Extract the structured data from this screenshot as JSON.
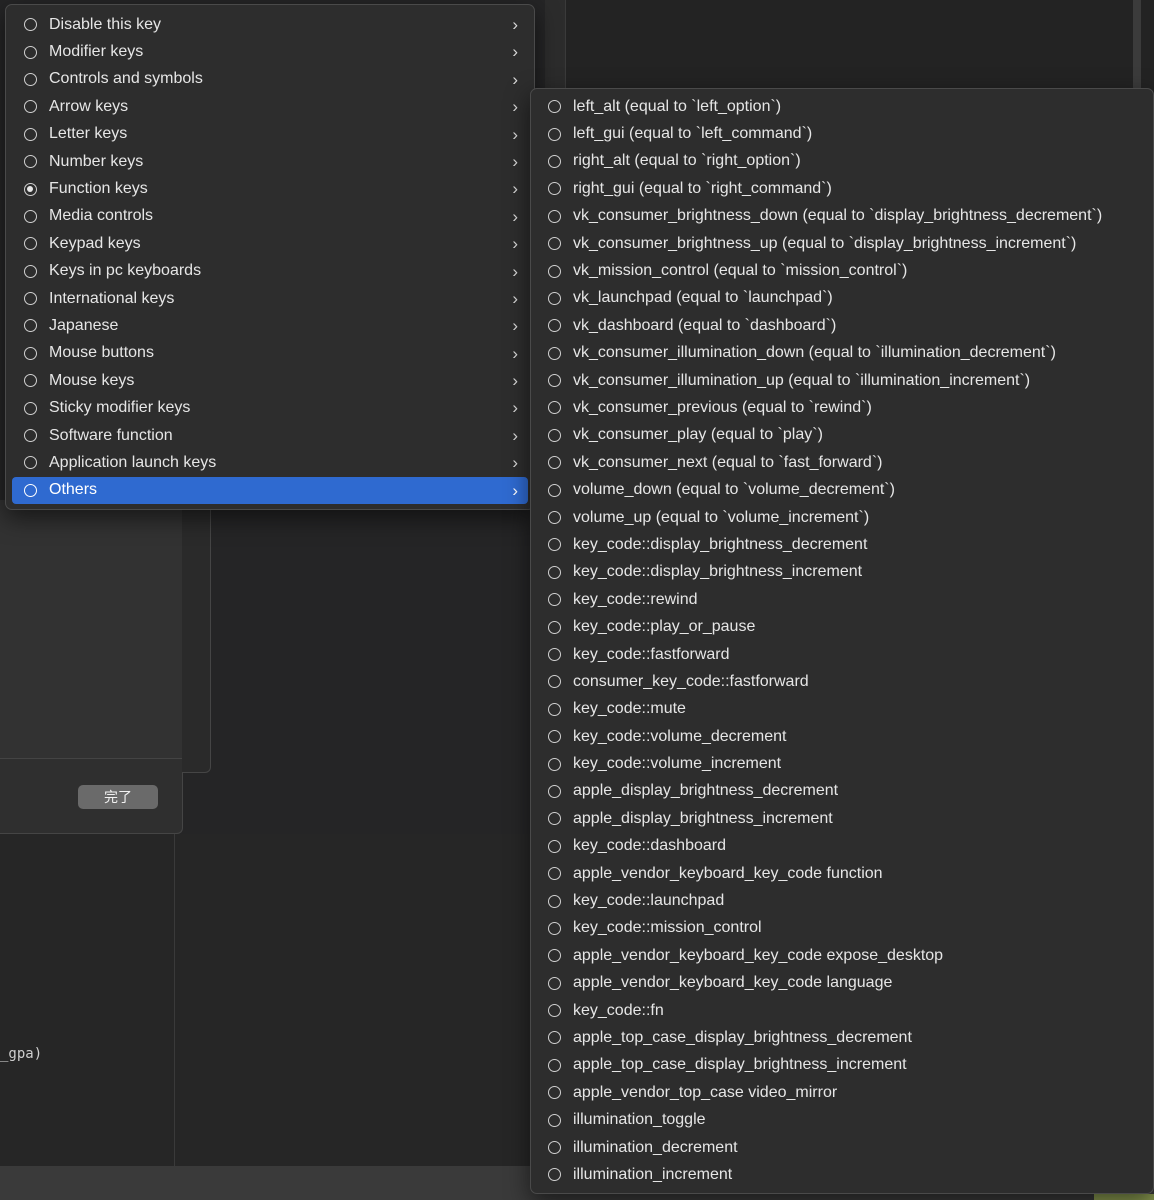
{
  "background": {
    "done_label": "完了",
    "code_fragment": "_gpa)"
  },
  "menu": {
    "items": [
      {
        "label": "Disable this key",
        "checked": false,
        "selected": false
      },
      {
        "label": "Modifier keys",
        "checked": false,
        "selected": false
      },
      {
        "label": "Controls and symbols",
        "checked": false,
        "selected": false
      },
      {
        "label": "Arrow keys",
        "checked": false,
        "selected": false
      },
      {
        "label": "Letter keys",
        "checked": false,
        "selected": false
      },
      {
        "label": "Number keys",
        "checked": false,
        "selected": false
      },
      {
        "label": "Function keys",
        "checked": true,
        "selected": false
      },
      {
        "label": "Media controls",
        "checked": false,
        "selected": false
      },
      {
        "label": "Keypad keys",
        "checked": false,
        "selected": false
      },
      {
        "label": "Keys in pc keyboards",
        "checked": false,
        "selected": false
      },
      {
        "label": "International keys",
        "checked": false,
        "selected": false
      },
      {
        "label": "Japanese",
        "checked": false,
        "selected": false
      },
      {
        "label": "Mouse buttons",
        "checked": false,
        "selected": false
      },
      {
        "label": "Mouse keys",
        "checked": false,
        "selected": false
      },
      {
        "label": "Sticky modifier keys",
        "checked": false,
        "selected": false
      },
      {
        "label": "Software function",
        "checked": false,
        "selected": false
      },
      {
        "label": "Application launch keys",
        "checked": false,
        "selected": false
      },
      {
        "label": "Others",
        "checked": false,
        "selected": true
      }
    ],
    "chevron": "›"
  },
  "submenu": {
    "items": [
      "left_alt (equal to `left_option`)",
      "left_gui (equal to `left_command`)",
      "right_alt (equal to `right_option`)",
      "right_gui (equal to `right_command`)",
      "vk_consumer_brightness_down (equal to `display_brightness_decrement`)",
      "vk_consumer_brightness_up (equal to `display_brightness_increment`)",
      "vk_mission_control (equal to `mission_control`)",
      "vk_launchpad (equal to `launchpad`)",
      "vk_dashboard (equal to `dashboard`)",
      "vk_consumer_illumination_down (equal to `illumination_decrement`)",
      "vk_consumer_illumination_up (equal to `illumination_increment`)",
      "vk_consumer_previous (equal to `rewind`)",
      "vk_consumer_play (equal to `play`)",
      "vk_consumer_next (equal to `fast_forward`)",
      "volume_down (equal to `volume_decrement`)",
      "volume_up (equal to `volume_increment`)",
      "key_code::display_brightness_decrement",
      "key_code::display_brightness_increment",
      "key_code::rewind",
      "key_code::play_or_pause",
      "key_code::fastforward",
      "consumer_key_code::fastforward",
      "key_code::mute",
      "key_code::volume_decrement",
      "key_code::volume_increment",
      "apple_display_brightness_decrement",
      "apple_display_brightness_increment",
      "key_code::dashboard",
      "apple_vendor_keyboard_key_code function",
      "key_code::launchpad",
      "key_code::mission_control",
      "apple_vendor_keyboard_key_code expose_desktop",
      "apple_vendor_keyboard_key_code language",
      "key_code::fn",
      "apple_top_case_display_brightness_decrement",
      "apple_top_case_display_brightness_increment",
      "apple_vendor_top_case video_mirror",
      "illumination_toggle",
      "illumination_decrement",
      "illumination_increment"
    ]
  }
}
